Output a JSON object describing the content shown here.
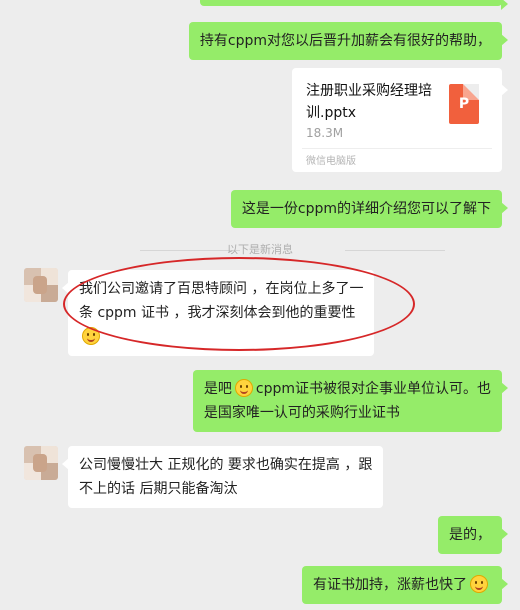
{
  "messages": {
    "m1": {
      "lines": [
        "持有cppm对您以后晋升加薪会有很好的帮助，"
      ]
    },
    "file": {
      "name_lines": [
        "注册职业采购经理培",
        "训.pptx"
      ],
      "size": "18.3M",
      "source": "微信电脑版",
      "icon": "ppt-file-icon"
    },
    "m2": {
      "lines": [
        "这是一份cppm的详细介绍您可以了解下"
      ]
    },
    "divider": "以下是新消息",
    "m3": {
      "lines": [
        "我们公司邀请了百思特顾问 ，在岗位上多了一",
        "条 cppm 证书 ，我才深刻体会到他的重要性"
      ]
    },
    "m4": {
      "prefix": "是吧",
      "rest": "cppm证书被很对企事业单位认可。也",
      "line2": "是国家唯一认可的采购行业证书"
    },
    "m5": {
      "lines": [
        "公司慢慢壮大 正规化的 要求也确实在提高 ，跟",
        "不上的话 后期只能备淘汰"
      ]
    },
    "m6": {
      "lines": [
        "是的，"
      ]
    },
    "m7": {
      "text": "有证书加持，涨薪也快了"
    }
  },
  "icons": {
    "emoji": "smiling-emoji-icon",
    "avatar": "contact-avatar"
  },
  "colors": {
    "my_bubble": "#95ec69",
    "their_bubble": "#ffffff",
    "background": "#ededed",
    "highlight": "#d62728"
  }
}
